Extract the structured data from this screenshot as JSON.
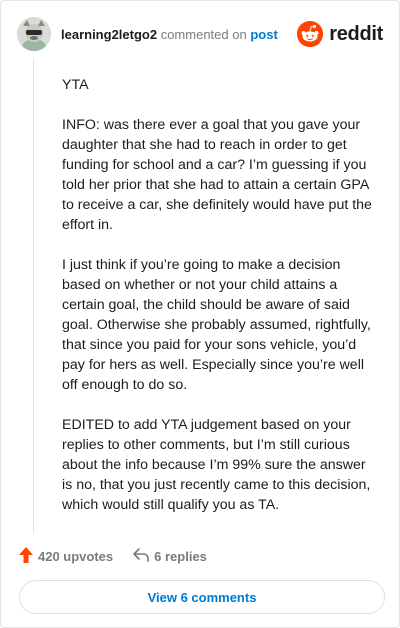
{
  "comment": {
    "username": "learning2letgo2",
    "commented_text": "commented on",
    "post_link": "post",
    "paragraphs": [
      "YTA",
      "INFO: was there ever a goal that you gave your daughter that she had to reach in order to get funding for school and a car? I’m guessing if you told her prior that she had to attain a certain GPA to receive a car, she definitely would have put the effort in.",
      "I just think if you’re going to make a decision based on whether or not your child attains a certain goal, the child should be aware of said goal. Otherwise she probably assumed, rightfully, that since you paid for your sons vehicle, you’d pay for hers as well. Especially since you’re well off enough to do so.",
      "EDITED to add YTA judgement based on your replies to other comments, but I’m still curious about the info because I’m 99% sure the answer is no, that you just recently came to this decision, which would still qualify you as TA."
    ],
    "upvotes_label": "420 upvotes",
    "replies_label": "6 replies"
  },
  "brand": {
    "wordmark": "reddit",
    "icon": "reddit-snoo-icon",
    "color": "#ff4500"
  },
  "icons": {
    "upvote": "upvote-arrow-icon",
    "reply": "reply-arrow-icon",
    "avatar": "avatar"
  },
  "accent_color": "#0079d3",
  "view_button": {
    "label": "View 6 comments"
  }
}
